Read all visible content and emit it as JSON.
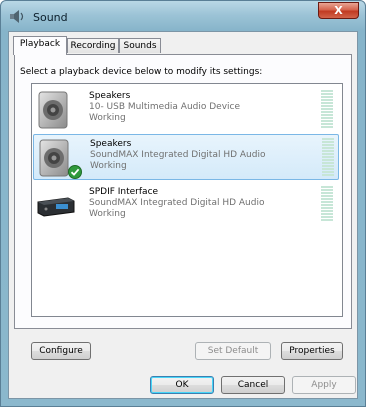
{
  "window": {
    "title": "Sound",
    "close_label": "X"
  },
  "tabs": [
    {
      "label": "Playback",
      "active": true
    },
    {
      "label": "Recording",
      "active": false
    },
    {
      "label": "Sounds",
      "active": false
    }
  ],
  "instruction": "Select a playback device below to modify its settings:",
  "devices": [
    {
      "name": "Speakers",
      "description": "10- USB Multimedia Audio Device",
      "status": "Working",
      "icon": "speaker-icon",
      "selected": false,
      "default": false
    },
    {
      "name": "Speakers",
      "description": "SoundMAX Integrated Digital HD Audio",
      "status": "Working",
      "icon": "speaker-icon",
      "selected": true,
      "default": true
    },
    {
      "name": "SPDIF Interface",
      "description": "SoundMAX Integrated Digital HD Audio",
      "status": "Working",
      "icon": "spdif-device-icon",
      "selected": false,
      "default": false
    }
  ],
  "buttons": {
    "configure": "Configure",
    "set_default": "Set Default",
    "properties": "Properties",
    "ok": "OK",
    "cancel": "Cancel",
    "apply": "Apply"
  },
  "colors": {
    "selection": "#d4eafa",
    "meter": "#c7e6d7",
    "title_bar": "#9cc3d6",
    "close_button": "#c13a22"
  }
}
